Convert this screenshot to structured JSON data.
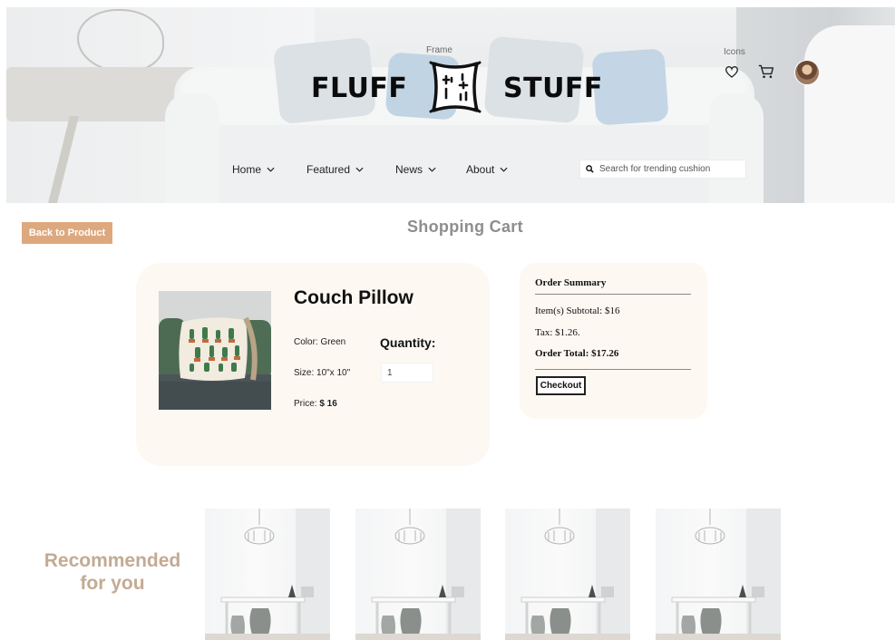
{
  "header": {
    "frame_label": "Frame",
    "brand_left": "FLUFF",
    "brand_right": "STUFF",
    "icons_label": "Icons"
  },
  "nav": {
    "items": [
      {
        "label": "Home"
      },
      {
        "label": "Featured"
      },
      {
        "label": "News"
      },
      {
        "label": "About"
      }
    ],
    "search_placeholder": "Search for trending cushion"
  },
  "cart": {
    "back_label": "Back to Product",
    "title": "Shopping Cart",
    "product": {
      "name": "Couch Pillow",
      "color": "Color: Green",
      "size": "Size: 10\"x 10\"",
      "price_label": "Price: ",
      "price_value": "$ 16",
      "quantity_label": "Quantity:",
      "quantity_value": "1"
    },
    "summary": {
      "title": "Order Summary",
      "subtotal": "Item(s) Subtotal: $16",
      "tax": "Tax: $1.26.",
      "total": "Order Total: $17.26",
      "checkout_label": "Checkout"
    }
  },
  "recommendations": {
    "title_line1": "Recommended",
    "title_line2": "for you",
    "count": 4
  },
  "colors": {
    "accent": "#dea87f",
    "card_bg": "#fdf8f2",
    "rec_title": "#c4aa93",
    "muted_title": "#8e8e8e"
  }
}
